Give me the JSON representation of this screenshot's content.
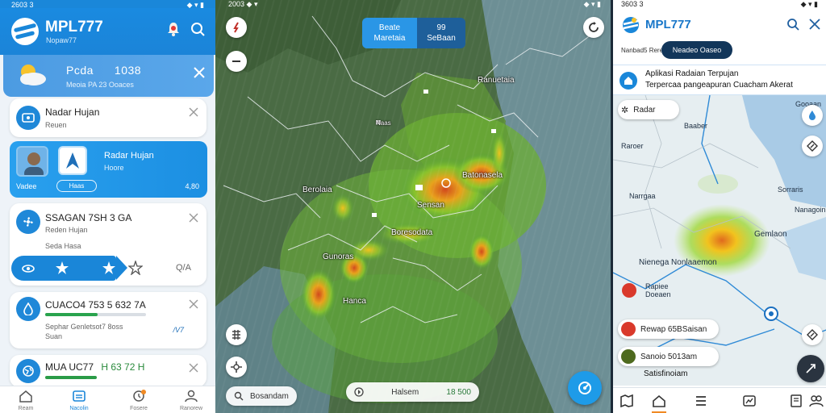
{
  "left": {
    "status": {
      "time": "2603 3",
      "icons": "◆ ▾ ▮"
    },
    "header": {
      "app_name": "MPL777",
      "subtitle": "Nopaw77"
    },
    "weather": {
      "place": "Pcda",
      "value": "1038",
      "sub": "Meoia PA 23 Ooaces"
    },
    "cards": [
      {
        "title": "Nadar Hujan",
        "sub": "Reuen"
      },
      {
        "title": "Radar Hujan",
        "sub": "Hoore",
        "left": "Vadee",
        "pill": "Haas",
        "right": "4,80"
      },
      {
        "title": "SSAGAN 7SH 3 GA",
        "sub1": "Reden Hujan",
        "sub2": "Seda Hasa",
        "rating": "Q/A"
      },
      {
        "title": "CUACO4 753 5 632 7A",
        "sub1": "Sephar Genletsot7 8oss",
        "sub2": "Suan",
        "speed": "/V7"
      },
      {
        "title": "MUA UC77",
        "value": "H 63 72 H"
      }
    ],
    "nav": [
      "Ream",
      "Nacolin",
      "Fosere",
      "Ranorew"
    ]
  },
  "map": {
    "status": "2003 ◆ ▾",
    "status_right": "◆ ▾ ▮",
    "top_chip": {
      "a": "Beate\nMaretaia",
      "b": "99\nSeBaan"
    },
    "labels": [
      {
        "text": "Ranuetaia",
        "pos": "a"
      },
      {
        "text": "Batonasela",
        "pos": "b"
      },
      {
        "text": "Berolaia",
        "pos": "c"
      },
      {
        "text": "Sensan",
        "pos": "d"
      },
      {
        "text": "Boresodata",
        "pos": "e"
      },
      {
        "text": "Gunoras",
        "pos": "f"
      },
      {
        "text": "Hanca",
        "pos": "g"
      },
      {
        "text": "Naas",
        "pos": "h"
      }
    ],
    "chip_left": "Bosandam",
    "chip_center": {
      "label": "Halsem",
      "value": "18 500"
    }
  },
  "right": {
    "status": "3603 3",
    "status_right": "◆ ▾ ▮",
    "header": {
      "app_name": "MPL777",
      "subtitle": "Nanbad5 Rerer",
      "pill": "Neadeo Oaseo"
    },
    "info": {
      "line1": "Aplikasi Radaian Terpujan",
      "line2": "Terpercaa pangeapuran Cuacham Akerat"
    },
    "radar_chip": "Radar",
    "labels": [
      "Gooaan",
      "Baaber",
      "Raroer",
      "Sorraris",
      "Narrgaa",
      "Nanagoin",
      "Gemlaon",
      "Nienega Nonlaaemon",
      "Rapiee\nDoeaen"
    ],
    "chips": [
      "Rewap 65BSaisan",
      "Sanoio 5013am",
      "Satisfinoiam"
    ],
    "nav_icons": [
      "map-icon",
      "home-icon",
      "list-icon",
      "chart-icon",
      "doc-icon",
      "people-icon"
    ]
  }
}
